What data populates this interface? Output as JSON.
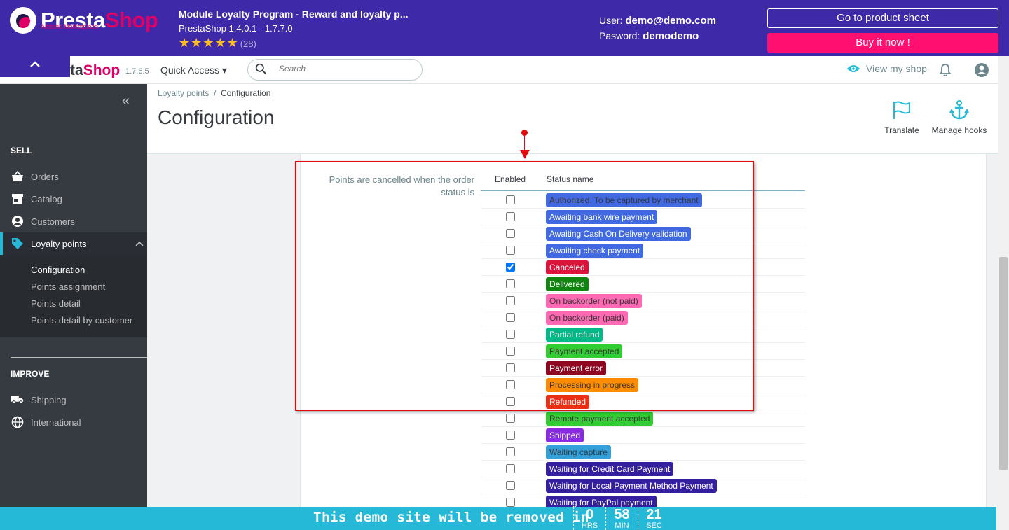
{
  "banner": {
    "logo_main": "Presta",
    "logo_accent": "Shop",
    "logo_sub": "Addons Marketplace",
    "module_title": "Module Loyalty Program - Reward and loyalty p...",
    "module_version": "PrestaShop 1.4.0.1 - 1.7.7.0",
    "stars": "★★★★★",
    "rating_count": "(28)",
    "user_label": "User:",
    "user_value": "demo@demo.com",
    "password_label": "Pasword:",
    "password_value": "demodemo",
    "product_sheet_btn": "Go to product sheet",
    "buy_btn": "Buy it now !"
  },
  "header": {
    "collapse_icon": "chevron-up-icon",
    "logo_part1": "ta",
    "logo_part2": "Shop",
    "version": "1.7.6.5",
    "quick_access": "Quick Access ▾",
    "search_placeholder": "Search",
    "view_shop": "View my shop"
  },
  "sidebar": {
    "sell_title": "SELL",
    "items": [
      {
        "label": "Orders",
        "icon": "shopping-basket-icon"
      },
      {
        "label": "Catalog",
        "icon": "store-icon"
      },
      {
        "label": "Customers",
        "icon": "account-circle-icon"
      },
      {
        "label": "Loyalty points",
        "icon": "tag-icon"
      }
    ],
    "subitems": [
      "Configuration",
      "Points assignment",
      "Points detail",
      "Points detail by customer"
    ],
    "improve_title": "IMPROVE",
    "improve_items": [
      {
        "label": "Shipping",
        "icon": "truck-icon"
      },
      {
        "label": "International",
        "icon": "globe-icon"
      }
    ]
  },
  "page": {
    "breadcrumb_parent": "Loyalty points",
    "breadcrumb_sep": "/",
    "breadcrumb_current": "Configuration",
    "title": "Configuration",
    "translate_label": "Translate",
    "hooks_label": "Manage hooks"
  },
  "form": {
    "label_line1": "Points are cancelled when the order",
    "label_line2": "status is",
    "col_enabled": "Enabled",
    "col_status": "Status name",
    "statuses": [
      {
        "name": "Authorized. To be captured by merchant",
        "color": "#4169e1",
        "text": "#383838",
        "checked": false
      },
      {
        "name": "Awaiting bank wire payment",
        "color": "#4169e1",
        "text": "#ffffff",
        "checked": false
      },
      {
        "name": "Awaiting Cash On Delivery validation",
        "color": "#4169e1",
        "text": "#ffffff",
        "checked": false
      },
      {
        "name": "Awaiting check payment",
        "color": "#4169e1",
        "text": "#ffffff",
        "checked": false
      },
      {
        "name": "Canceled",
        "color": "#dc143c",
        "text": "#ffffff",
        "checked": true
      },
      {
        "name": "Delivered",
        "color": "#108510",
        "text": "#ffffff",
        "checked": false
      },
      {
        "name": "On backorder (not paid)",
        "color": "#ff69b4",
        "text": "#383838",
        "checked": false
      },
      {
        "name": "On backorder (paid)",
        "color": "#ff69b4",
        "text": "#383838",
        "checked": false
      },
      {
        "name": "Partial refund",
        "color": "#01b887",
        "text": "#ffffff",
        "checked": false
      },
      {
        "name": "Payment accepted",
        "color": "#32cd32",
        "text": "#383838",
        "checked": false
      },
      {
        "name": "Payment error",
        "color": "#8f0621",
        "text": "#ffffff",
        "checked": false
      },
      {
        "name": "Processing in progress",
        "color": "#ff8c00",
        "text": "#383838",
        "checked": false
      },
      {
        "name": "Refunded",
        "color": "#ec2e15",
        "text": "#ffffff",
        "checked": false
      },
      {
        "name": "Remote payment accepted",
        "color": "#32cd32",
        "text": "#383838",
        "checked": false
      },
      {
        "name": "Shipped",
        "color": "#8a2be2",
        "text": "#ffffff",
        "checked": false
      },
      {
        "name": "Waiting capture",
        "color": "#34a0d9",
        "text": "#383838",
        "checked": false
      },
      {
        "name": "Waiting for Credit Card Payment",
        "color": "#34209e",
        "text": "#ffffff",
        "checked": false
      },
      {
        "name": "Waiting for Local Payment Method Payment",
        "color": "#34209e",
        "text": "#ffffff",
        "checked": false
      },
      {
        "name": "Waiting for PayPal payment",
        "color": "#34209e",
        "text": "#ffffff",
        "checked": false
      }
    ]
  },
  "countdown": {
    "message": "This demo site will be removed in",
    "hours": "0",
    "hours_label": "HRS",
    "minutes": "58",
    "minutes_label": "MIN",
    "seconds": "21",
    "seconds_label": "SEC"
  }
}
